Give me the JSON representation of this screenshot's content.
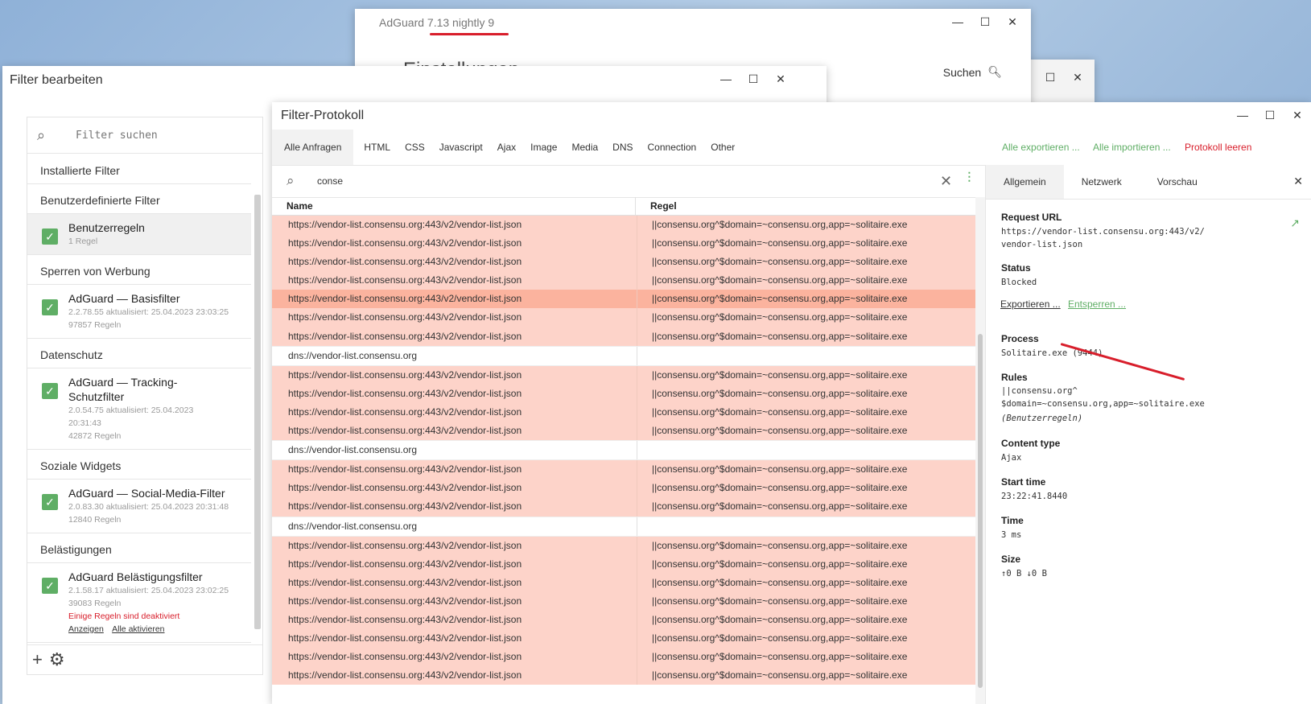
{
  "main_window": {
    "title": "AdGuard 7.13 nightly 9",
    "heading": "Einstellungen",
    "search_label": "Suchen"
  },
  "filter_window": {
    "title": "Filter bearbeiten",
    "search_placeholder": "Filter suchen",
    "installed_label": "Installierte Filter",
    "sections": [
      {
        "heading": "Benutzerdefinierte Filter",
        "items": [
          {
            "name": "Benutzerregeln",
            "meta": "1 Regel"
          }
        ]
      },
      {
        "heading": "Sperren von Werbung",
        "items": [
          {
            "name": "AdGuard — Basisfilter",
            "meta": "2.2.78.55 aktualisiert: 25.04.2023 23:03:25",
            "meta2": "97857 Regeln"
          }
        ]
      },
      {
        "heading": "Datenschutz",
        "items": [
          {
            "name": "AdGuard — Tracking-Schutzfilter",
            "meta": "2.0.54.75 aktualisiert: 25.04.2023 20:31:43",
            "meta2": "42872 Regeln"
          }
        ]
      },
      {
        "heading": "Soziale Widgets",
        "items": [
          {
            "name": "AdGuard — Social-Media-Filter",
            "meta": "2.0.83.30 aktualisiert: 25.04.2023 20:31:48",
            "meta2": "12840 Regeln"
          }
        ]
      },
      {
        "heading": "Belästigungen",
        "items": [
          {
            "name": "AdGuard Belästigungsfilter",
            "meta": "2.1.58.17 aktualisiert: 25.04.2023 23:02:25",
            "meta2": "39083 Regeln",
            "warn": "Einige Regeln sind deaktiviert",
            "link1": "Anzeigen",
            "link2": "Alle aktivieren"
          }
        ]
      }
    ]
  },
  "log_window": {
    "title": "Filter-Protokoll",
    "tabs": [
      "Alle Anfragen",
      "HTML",
      "CSS",
      "Javascript",
      "Ajax",
      "Image",
      "Media",
      "DNS",
      "Connection",
      "Other"
    ],
    "actions": {
      "export": "Alle exportieren ...",
      "import": "Alle importieren ...",
      "clear": "Protokoll leeren"
    },
    "search_value": "conse",
    "col_name": "Name",
    "col_rule": "Regel",
    "blocked_url": "https://vendor-list.consensu.org:443/v2/vendor-list.json",
    "blocked_rule": "||consensu.org^$domain=~consensu.org,app=~solitaire.exe",
    "dns_url": "dns://vendor-list.consensu.org",
    "row_kinds": [
      "b",
      "b",
      "b",
      "b",
      "s",
      "b",
      "b",
      "d",
      "b",
      "b",
      "b",
      "b",
      "d",
      "b",
      "b",
      "b",
      "d",
      "b",
      "b",
      "b",
      "b",
      "b",
      "b",
      "b",
      "b"
    ]
  },
  "detail": {
    "tabs": [
      "Allgemein",
      "Netzwerk",
      "Vorschau"
    ],
    "request_url_label": "Request URL",
    "request_url_1": "https://vendor-list.consensu.org:443/v2/",
    "request_url_2": "vendor-list.json",
    "status_label": "Status",
    "status_value": "Blocked",
    "export_link": "Exportieren ...",
    "unblock_link": "Entsperren ...",
    "process_label": "Process",
    "process_value": "Solitaire.exe (9444)",
    "rules_label": "Rules",
    "rules_line1": "||consensu.org^",
    "rules_line2": "$domain=~consensu.org,app=~solitaire.exe",
    "rules_source": "(Benutzerregeln)",
    "content_type_label": "Content type",
    "content_type_value": "Ajax",
    "start_time_label": "Start time",
    "start_time_value": "23:22:41.8440",
    "time_label": "Time",
    "time_value": "3 ms",
    "size_label": "Size",
    "size_value": "↑0 B ↓0 B"
  },
  "colors": {
    "accent_green": "#5fae65",
    "accent_red": "#d81e2b",
    "blocked_row": "#fdd3c9",
    "selected_row": "#fbb39e"
  }
}
